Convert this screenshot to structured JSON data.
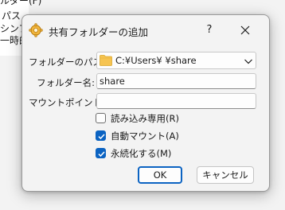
{
  "background": {
    "cut_text": "ルダー(F)",
    "lines": [
      "パス",
      "シンプ",
      "一時的"
    ]
  },
  "dialog": {
    "title": "共有フォルダーの追加",
    "help_label": "?",
    "fields": {
      "path_label": "フォルダーのパス:",
      "path_value": "C:¥Users¥        ¥share",
      "name_label": "フォルダー名:",
      "name_value": "share",
      "mount_label": "マウントポイント:",
      "mount_value": ""
    },
    "checkboxes": [
      {
        "label": "読み込み専用(R)",
        "checked": false
      },
      {
        "label": "自動マウント(A)",
        "checked": true
      },
      {
        "label": "永続化する(M)",
        "checked": true
      }
    ],
    "buttons": {
      "ok": "OK",
      "cancel": "キャンセル"
    }
  },
  "colors": {
    "accent": "#0b63c2",
    "folder": "#f6c451"
  },
  "icons": {
    "title": "shared-folder-gear-icon",
    "close": "close-icon",
    "folder": "folder-icon",
    "dropdown": "chevron-down-icon",
    "check": "checkmark-icon"
  }
}
